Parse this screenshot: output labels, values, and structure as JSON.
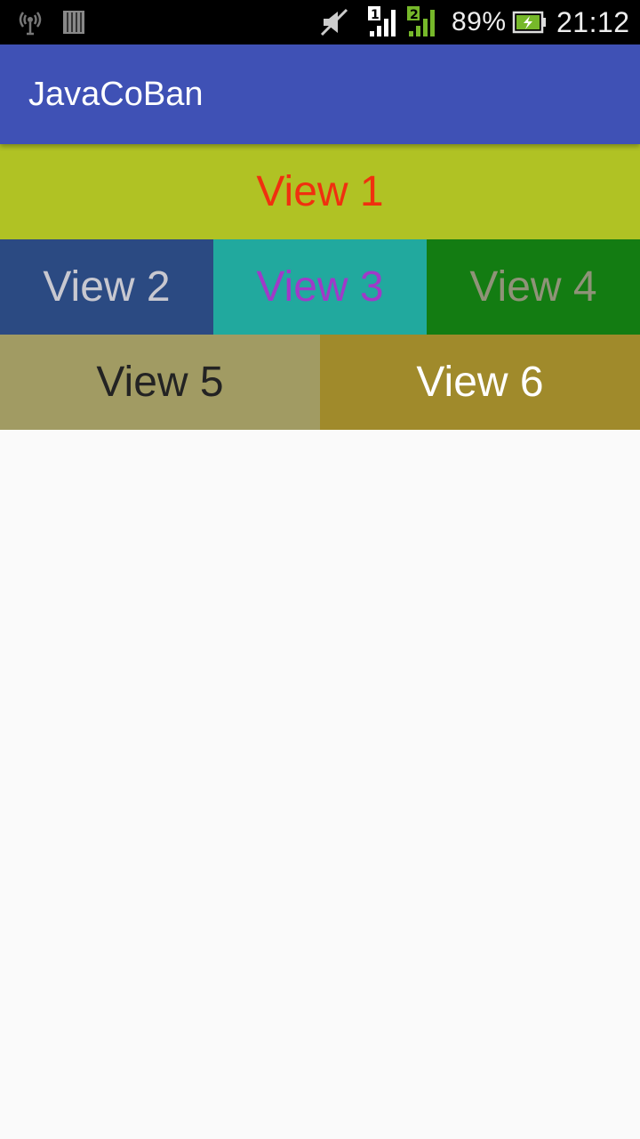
{
  "status_bar": {
    "battery_percent": "89%",
    "time": "21:12",
    "icons": [
      "usb-debug-icon",
      "sd-card-icon",
      "mute-icon",
      "sim1-signal-icon",
      "sim2-signal-icon",
      "battery-charging-icon"
    ],
    "sim1_label": "1",
    "sim2_label": "2"
  },
  "app_bar": {
    "title": "JavaCoBan",
    "color": "#3f51b5"
  },
  "views": {
    "view1": {
      "label": "View 1",
      "bg": "#b0c224",
      "fg": "#f0300f"
    },
    "view2": {
      "label": "View 2",
      "bg": "#2b4a82",
      "fg": "#c8c8d0"
    },
    "view3": {
      "label": "View 3",
      "bg": "#21a99e",
      "fg": "#a03ac8"
    },
    "view4": {
      "label": "View 4",
      "bg": "#137c12",
      "fg": "#8f9378"
    },
    "view5": {
      "label": "View 5",
      "bg": "#a19b63",
      "fg": "#232323"
    },
    "view6": {
      "label": "View 6",
      "bg": "#a08a2b",
      "fg": "#ffffff"
    }
  }
}
